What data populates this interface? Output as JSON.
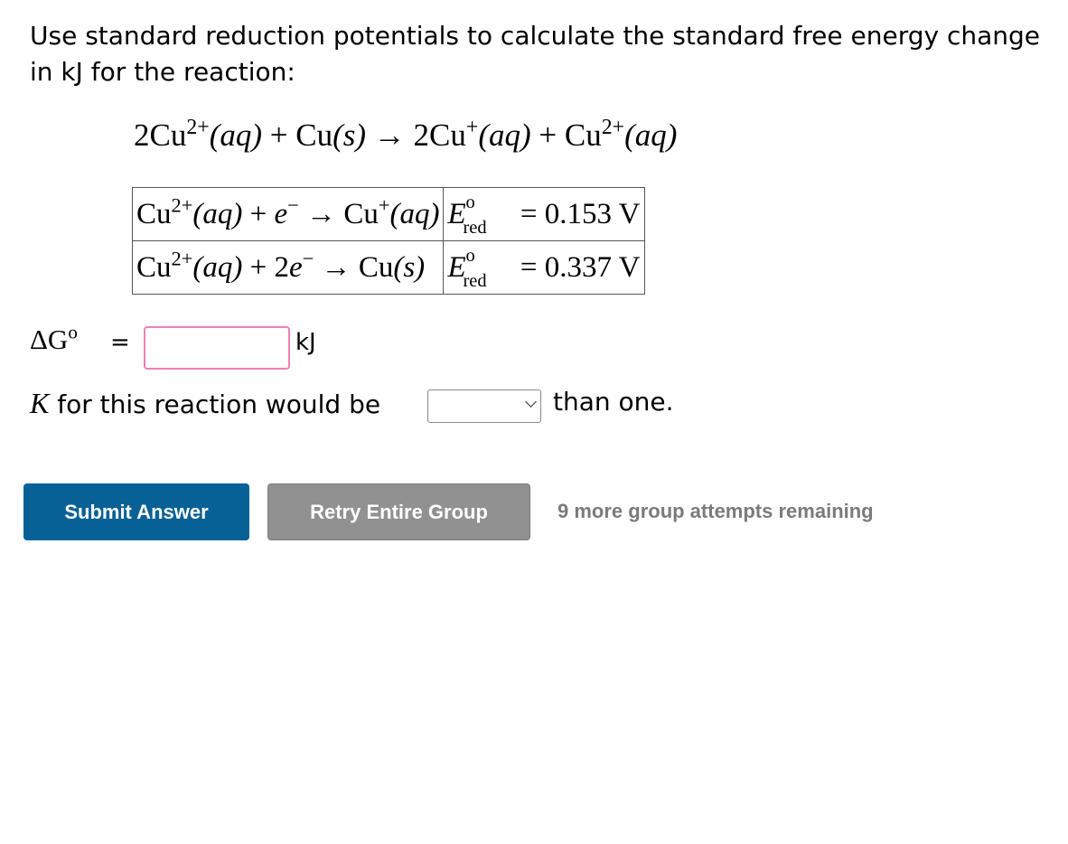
{
  "question": {
    "text": "Use standard reduction potentials to calculate the standard free energy change in kJ for the reaction:"
  },
  "reaction": {
    "r1": "2Cu",
    "r1_charge": "2+",
    "r1_state": "(aq)",
    "plus1": " + ",
    "r2": "Cu",
    "r2_state": "(s)",
    "arrow": " → ",
    "p1": "2Cu",
    "p1_charge": "+",
    "p1_state": "(aq)",
    "plus2": " + ",
    "p2": "Cu",
    "p2_charge": "2+",
    "p2_state": "(aq)"
  },
  "half_reactions": [
    {
      "lhs_species": "Cu",
      "lhs_charge": "2+",
      "lhs_state": "(aq)",
      "plus": " + ",
      "electrons": "e",
      "e_charge": "−",
      "arrow": " → ",
      "product": "Cu",
      "product_charge": "+",
      "product_state": "(aq)",
      "E": "E",
      "E_sup": "o",
      "E_sub": "red",
      "value": " = 0.153 V"
    },
    {
      "lhs_species": "Cu",
      "lhs_charge": "2+",
      "lhs_state": "(aq)",
      "plus": " + 2",
      "electrons": "e",
      "e_charge": "−",
      "arrow": " → ",
      "product": "Cu",
      "product_charge": "",
      "product_state": "(s)",
      "E": "E",
      "E_sup": "o",
      "E_sub": "red",
      "value": " = 0.337 V"
    }
  ],
  "delta_g": {
    "symbol": "ΔG",
    "sup": "o",
    "equals": "=",
    "input_value": "",
    "unit": "kJ"
  },
  "k_line": {
    "symbol": "K",
    "prefix": " for this reaction would be",
    "selected": "",
    "suffix": "than one."
  },
  "buttons": {
    "submit": "Submit Answer",
    "retry": "Retry Entire Group"
  },
  "attempts": "9 more group attempts remaining",
  "colors": {
    "submit": "#086196",
    "retry": "#919191",
    "input_border": "#f07fb4"
  }
}
